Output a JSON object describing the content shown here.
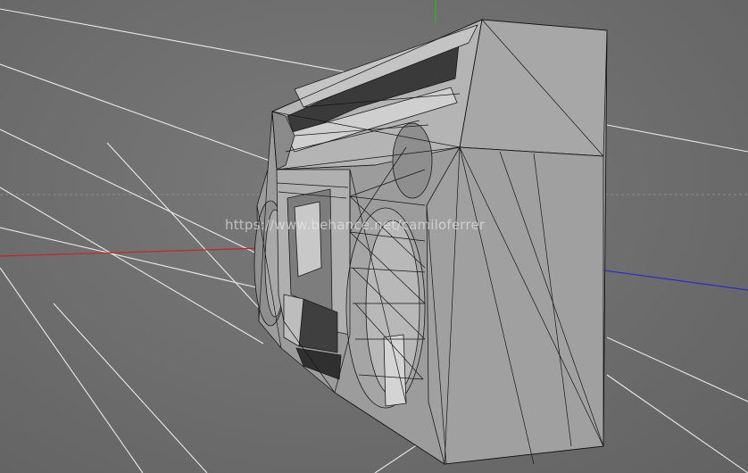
{
  "viewport": {
    "background_color": "#6e6e6e",
    "grid_line_color": "#ffffff",
    "model_fill_color": "#a2a2a2",
    "wire_color": "#1a1a1a"
  },
  "axes": {
    "x_axis_color": "#c8252b",
    "y_axis_color": "#2db52d",
    "z_axis_color": "#2b2bc8"
  },
  "watermark": {
    "text": "https://www.behance.net/camiloferrer"
  }
}
